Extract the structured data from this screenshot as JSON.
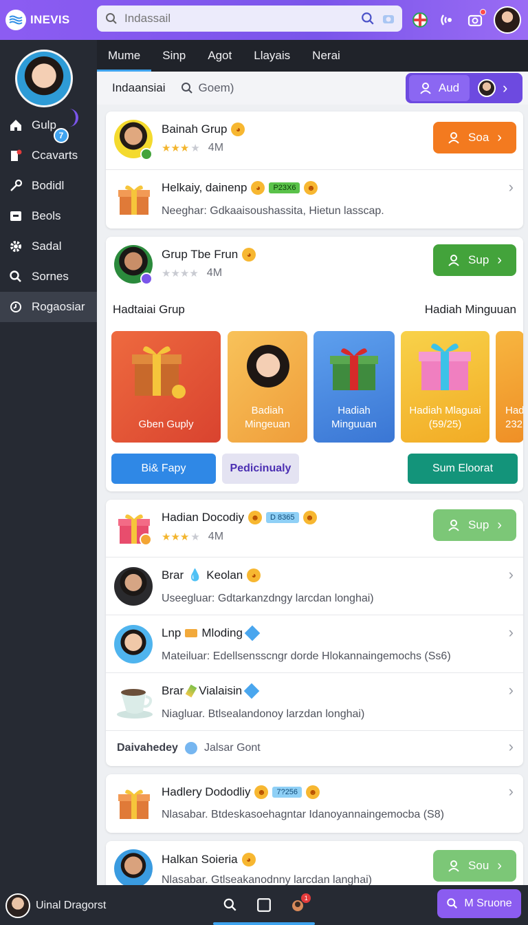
{
  "app": {
    "name": "INEVIS"
  },
  "search": {
    "placeholder": "Indassail"
  },
  "tabs": [
    "Mume",
    "Sinp",
    "Agot",
    "Llayais",
    "Nerai"
  ],
  "sidebar": {
    "profile_badge": "7",
    "items": [
      {
        "label": "Gulp",
        "icon": "home-icon"
      },
      {
        "label": "Ccavarts",
        "icon": "doc-pen-icon"
      },
      {
        "label": "Bodidl",
        "icon": "key-icon"
      },
      {
        "label": "Beols",
        "icon": "box-icon"
      },
      {
        "label": "Sadal",
        "icon": "gear-icon"
      },
      {
        "label": "Sornes",
        "icon": "search-icon"
      },
      {
        "label": "Rogaosiar",
        "icon": "clock-icon"
      }
    ]
  },
  "subheader": {
    "breadcrumb": "Indaansiai",
    "search_label": "Goem)",
    "aud_label": "Aud"
  },
  "card1": {
    "title": "Bainah Grup",
    "stars": 3,
    "count": "4M",
    "button": "Soa",
    "row2_title": "Helkaiy, dainenp",
    "row2_tag": "P23X6",
    "row2_sub": "Neeghar: Gdkaaisoushassita, Hietun lasscap."
  },
  "card2": {
    "title": "Grup Tbe Frun",
    "stars": 0,
    "count": "4M",
    "button": "Sup",
    "section_left": "Hadtaiai Grup",
    "section_right": "Hadiah Minguuan",
    "tiles": [
      {
        "label": "Gben Guply",
        "color": "#e8553a"
      },
      {
        "label": "Badiah Mingeuan",
        "color": "#f3b04a"
      },
      {
        "label": "Hadiah Minguuan",
        "color": "#4b8fe6"
      },
      {
        "label": "Hadiah Mlaguai (59/25)",
        "color": "#f5c02c"
      },
      {
        "label": "Had 232",
        "color": "#f3a534"
      }
    ],
    "btn_blue": "Bi& Fapy",
    "btn_purple": "Pedicinualy",
    "btn_green": "Sum Eloorat"
  },
  "card3": {
    "rows": [
      {
        "title": "Hadian Docodiy",
        "tag": "D 8365",
        "stars": 3,
        "count": "4M",
        "button": "Sup"
      },
      {
        "title": "Brar",
        "title2": "Keolan",
        "sub": "Useegluar: Gdtarkanzdngy larcdan longhai)"
      },
      {
        "title": "Lnp",
        "title2": "Mloding",
        "sub": "Mateiluar: Edellsensscngr dorde Hlokannaingemochs  (Ss6)"
      },
      {
        "title": "Brar",
        "title2": "Vialaisin",
        "sub": "Niagluar. Btlsealandonoy larzdan longhai)"
      }
    ],
    "footer_bold": "Daivahedey",
    "footer_text": "Jalsar Gont"
  },
  "card4": {
    "title": "Hadlery Dododliy",
    "tag": "7?256",
    "sub": "Nlasabar. Btdeskasoehagntar Idanoyannaingemocba  (S8)"
  },
  "card5": {
    "title": "Halkan Soieria",
    "sub": "Nlasabar. Gtlseakanodnny larcdan langhai)",
    "button": "Sou"
  },
  "bottombar": {
    "user": "Uinal Dragorst",
    "button": "M Sruone",
    "notif": "1"
  },
  "colors": {
    "accent": "#7a55ea",
    "orange": "#f37a1f",
    "green": "#43a33b",
    "teal": "#13947a",
    "blue": "#2f88e6"
  }
}
